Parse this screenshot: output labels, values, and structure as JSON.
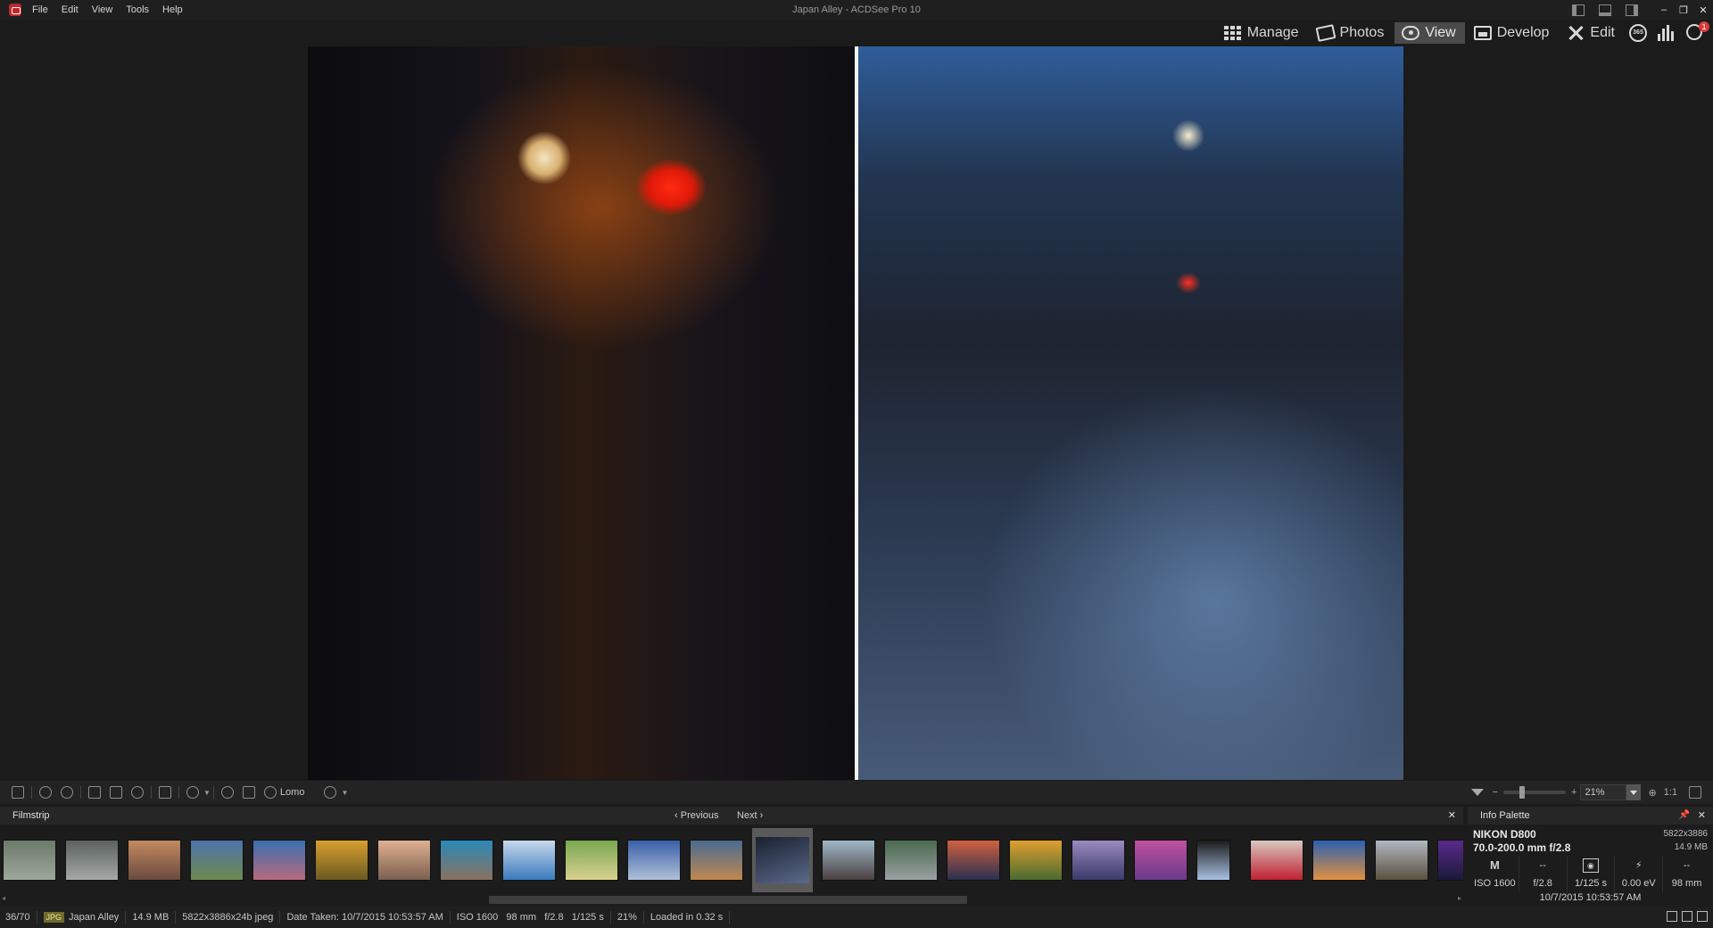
{
  "app": {
    "window_title": "Japan Alley - ACDSee Pro 10",
    "menu": [
      "File",
      "Edit",
      "View",
      "Tools",
      "Help"
    ]
  },
  "modes": {
    "manage": "Manage",
    "photos": "Photos",
    "view": "View",
    "develop": "Develop",
    "edit": "Edit",
    "round_icon_text": "365",
    "notification_count": "1"
  },
  "viewer_toolbar": {
    "preset_label": "Lomo",
    "zoom_value": "21%",
    "actual_size": "1:1",
    "zoom_fraction": 0.28
  },
  "filmstrip": {
    "title": "Filmstrip",
    "previous": "Previous",
    "next": "Next",
    "close": "✕",
    "thumbnails": [
      {
        "name": "foggy-forest",
        "colors": [
          "#6b7a6a",
          "#9ea89a"
        ]
      },
      {
        "name": "misty-road",
        "colors": [
          "#5a6160",
          "#a4a9a6"
        ]
      },
      {
        "name": "sunset-city",
        "colors": [
          "#c28a60",
          "#6a4a40"
        ]
      },
      {
        "name": "cloudy-field",
        "colors": [
          "#4d73a8",
          "#6d8a50"
        ]
      },
      {
        "name": "flowers-sky",
        "colors": [
          "#3a6fb0",
          "#b86a80"
        ]
      },
      {
        "name": "golden-field",
        "colors": [
          "#d8a030",
          "#6a5a20"
        ]
      },
      {
        "name": "beach-rider",
        "colors": [
          "#e0b090",
          "#7a6050"
        ]
      },
      {
        "name": "coast-rocks",
        "colors": [
          "#2a8ab8",
          "#8a7060"
        ]
      },
      {
        "name": "snowy-town",
        "colors": [
          "#c8d8ec",
          "#3a7ac0"
        ]
      },
      {
        "name": "green-hills",
        "colors": [
          "#7aa850",
          "#d8d090"
        ]
      },
      {
        "name": "mountain-lake",
        "colors": [
          "#3a60a8",
          "#b0c0d8"
        ]
      },
      {
        "name": "harbor-dusk",
        "colors": [
          "#4a6a90",
          "#c08850"
        ]
      },
      {
        "name": "japan-alley",
        "colors": [
          "#1a2030",
          "#5a6a8a"
        ]
      },
      {
        "name": "interior-window",
        "colors": [
          "#a0b8c8",
          "#4a4040"
        ]
      },
      {
        "name": "canal-boat",
        "colors": [
          "#4a6a50",
          "#9aa0a0"
        ]
      },
      {
        "name": "pier-sunset",
        "colors": [
          "#d06040",
          "#2a3050"
        ]
      },
      {
        "name": "sunflower-field",
        "colors": [
          "#e0a030",
          "#4a6a30"
        ]
      },
      {
        "name": "purple-coast",
        "colors": [
          "#9a8ac0",
          "#3a3a6a"
        ]
      },
      {
        "name": "lavender-field",
        "colors": [
          "#c050a0",
          "#6a3a8a"
        ]
      },
      {
        "name": "arched-doorway",
        "colors": [
          "#1a1a1a",
          "#a8c0e0"
        ]
      },
      {
        "name": "red-dress",
        "colors": [
          "#d8c8c0",
          "#c02030"
        ]
      },
      {
        "name": "sunset-dock",
        "colors": [
          "#2a60b0",
          "#e09040"
        ]
      },
      {
        "name": "cliff-sea",
        "colors": [
          "#b0b8c0",
          "#5a5040"
        ]
      },
      {
        "name": "night-sky",
        "colors": [
          "#5a2a8a",
          "#1a1a3a"
        ]
      }
    ],
    "selected_index": 12
  },
  "info_palette": {
    "title": "Info Palette",
    "pin": "📌",
    "close": "✕",
    "camera": "NIKON D800",
    "lens": "70.0-200.0 mm f/2.8",
    "dimensions": "5822x3886",
    "file_size": "14.9 MB",
    "mode_row": [
      "M",
      "--",
      "◉",
      "⚡",
      "--"
    ],
    "exposure_row": [
      "ISO 1600",
      "f/2.8",
      "1/125 s",
      "0.00 eV",
      "98 mm"
    ],
    "date": "10/7/2015 10:53:57 AM"
  },
  "status": {
    "index": "36/70",
    "file_type": "JPG",
    "filename": "Japan Alley",
    "file_size": "14.9 MB",
    "image_info": "5822x3886x24b jpeg",
    "date_taken": "Date Taken: 10/7/2015 10:53:57 AM",
    "exposure": "ISO 1600   98 mm   f/2.8   1/125 s",
    "zoom": "21%",
    "load_time": "Loaded in 0.32 s"
  }
}
